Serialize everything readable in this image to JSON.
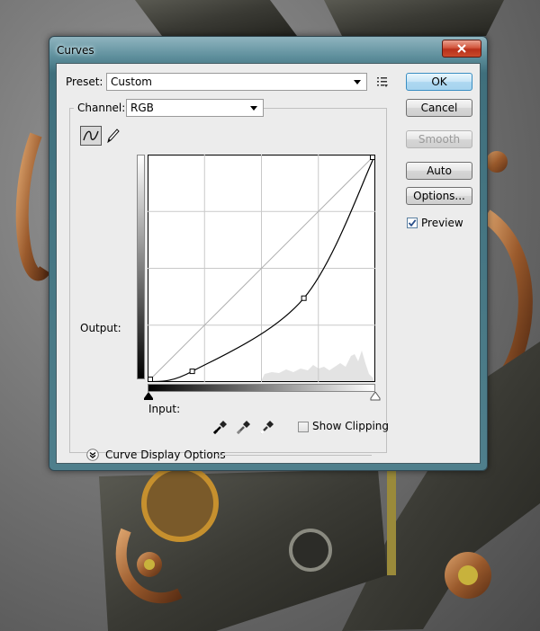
{
  "dialog": {
    "title": "Curves",
    "preset_label": "Preset:",
    "preset_value": "Custom",
    "channel_label": "Channel:",
    "channel_value": "RGB",
    "output_label": "Output:",
    "input_label": "Input:",
    "show_clipping_label": "Show Clipping",
    "show_clipping_checked": false,
    "curve_display_options_label": "Curve Display Options"
  },
  "buttons": {
    "ok": "OK",
    "cancel": "Cancel",
    "smooth": "Smooth",
    "auto": "Auto",
    "options": "Options..."
  },
  "preview": {
    "label": "Preview",
    "checked": true
  },
  "curve": {
    "grid": 4,
    "range": [
      0,
      255
    ],
    "points": [
      [
        0,
        0
      ],
      [
        50,
        12
      ],
      [
        175,
        94
      ],
      [
        255,
        255
      ]
    ]
  },
  "colors": {
    "accent": "#3a8ec2",
    "close_button": "#c94a2c",
    "title_bar": "#5e8f9c"
  }
}
